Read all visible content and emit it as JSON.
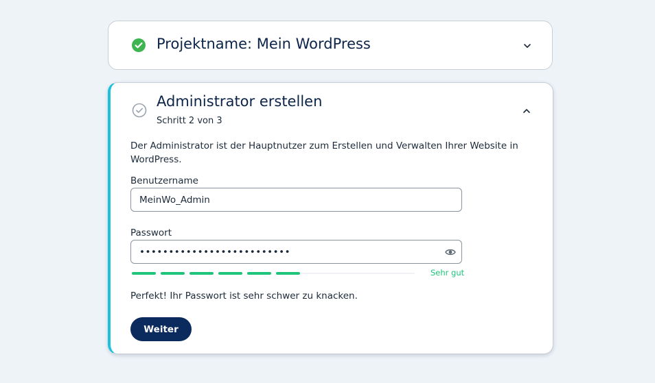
{
  "step1": {
    "title": "Projektname: Mein WordPress",
    "status_icon": "check-circle-filled-icon",
    "toggle_icon": "chevron-down-icon"
  },
  "step2": {
    "title": "Administrator erstellen",
    "subtitle": "Schritt 2 von 3",
    "status_icon": "check-circle-outline-icon",
    "toggle_icon": "chevron-up-icon",
    "description": "Der Administrator ist der Hauptnutzer zum Erstellen und Verwalten Ihrer Website in WordPress.",
    "username": {
      "label": "Benutzername",
      "value": "MeinWo_Admin"
    },
    "password": {
      "label": "Passwort",
      "value": "••••••••••••••••••••••••••",
      "reveal_icon": "eye-icon",
      "strength_label": "Sehr gut",
      "strength_segments_filled": 6,
      "strength_fraction": 0.6,
      "feedback": "Perfekt! Ihr Passwort ist sehr schwer zu knacken."
    },
    "button_label": "Weiter"
  },
  "colors": {
    "background": "#eef3f8",
    "accent": "#1ec1dc",
    "success": "#1ec47a",
    "check_done": "#3fb551",
    "primary_button": "#0b2a5e",
    "title": "#0b2447"
  }
}
